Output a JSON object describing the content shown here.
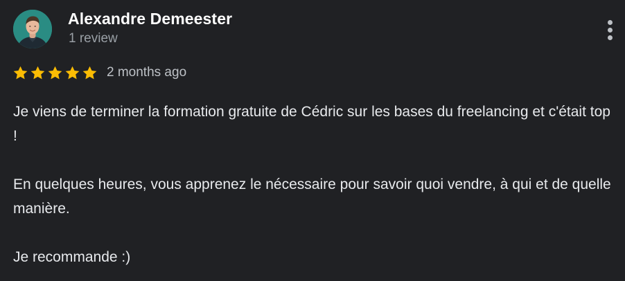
{
  "author": {
    "name": "Alexandre Demeester",
    "meta": "1 review",
    "avatar_icon": "profile-photo"
  },
  "review": {
    "rating": 5,
    "rating_max": 5,
    "date": "2 months ago",
    "paragraphs": [
      "Je viens de terminer la formation gratuite de Cédric sur les bases du freelancing et c'était top !",
      "En quelques heures, vous apprenez le nécessaire pour savoir quoi vendre, à qui et de quelle manière.",
      "Je recommande :)"
    ]
  },
  "icons": {
    "star": "star-icon",
    "more": "more-vert-icon"
  },
  "colors": {
    "background": "#202124",
    "star": "#fbbc04",
    "name": "#ffffff",
    "meta": "#9aa0a6",
    "text": "#e8eaed",
    "avatar_bg": "#2a8c83"
  }
}
